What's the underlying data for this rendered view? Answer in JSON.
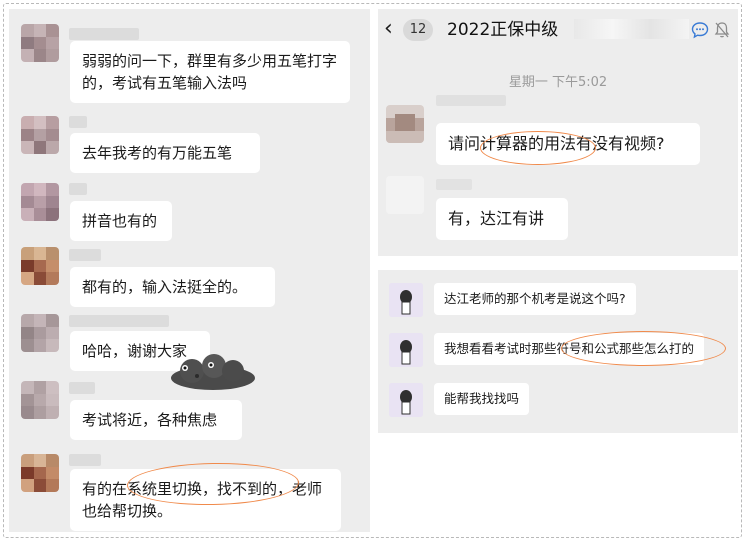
{
  "left_chat": {
    "messages": [
      {
        "text": "弱弱的问一下，群里有多少用五笔打字的，考试有五笔输入法吗"
      },
      {
        "text": "去年我考的有万能五笔"
      },
      {
        "text": "拼音也有的"
      },
      {
        "text": "都有的，输入法挺全的。"
      },
      {
        "text": "哈哈，谢谢大家"
      },
      {
        "text": "考试将近，各种焦虑"
      },
      {
        "text": "有的在系统里切换，找不到的，老师也给帮切换。"
      }
    ]
  },
  "right_chat": {
    "header": {
      "unread_count": "12",
      "title": "2022正保中级",
      "back_icon": "chevron-left-icon",
      "icons": [
        "chat-bubble-icon",
        "mute-bell-icon"
      ]
    },
    "timestamp": "星期一 下午5:02",
    "messages": [
      {
        "text": "请问计算器的用法有没有视频?"
      },
      {
        "text": "有，达江有讲"
      }
    ]
  },
  "small_chat": {
    "messages": [
      {
        "text": "达江老师的那个机考是说这个吗?"
      },
      {
        "text": "我想看看考试时那些符号和公式那些怎么打的"
      },
      {
        "text": "能帮我找找吗"
      }
    ]
  },
  "colors": {
    "panel_bg": "#ededed",
    "bubble_bg": "#ffffff",
    "highlight": "#f08a4b"
  }
}
